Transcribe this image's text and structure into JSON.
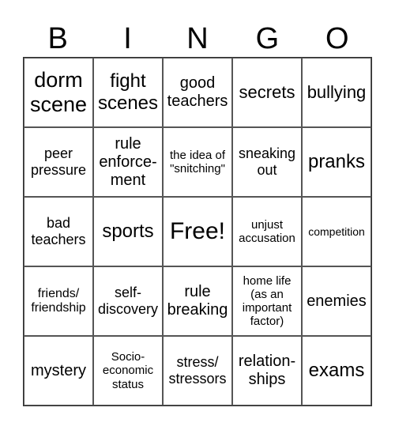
{
  "header": {
    "letters": [
      "B",
      "I",
      "N",
      "G",
      "O"
    ]
  },
  "grid": {
    "rows": [
      [
        "dorm\nscene",
        "fight\nscenes",
        "good\nteachers",
        "secrets",
        "bullying"
      ],
      [
        "peer\npressure",
        "rule\nenforce-\nment",
        "the idea of\n\"snitching\"",
        "sneaking\nout",
        "pranks"
      ],
      [
        "bad\nteachers",
        "sports",
        "Free!",
        "unjust\naccusation",
        "competition"
      ],
      [
        "friends/\nfriendship",
        "self-\ndiscovery",
        "rule\nbreaking",
        "home life\n(as an\nimportant\nfactor)",
        "enemies"
      ],
      [
        "mystery",
        "Socio-\neconomic\nstatus",
        "stress/\nstressors",
        "relation-\nships",
        "exams"
      ]
    ]
  }
}
